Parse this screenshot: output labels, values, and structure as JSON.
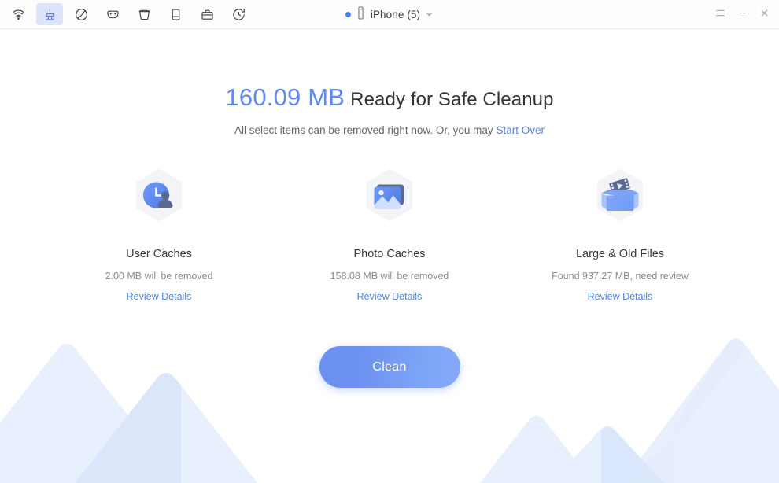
{
  "window": {
    "toolbar_icons": [
      {
        "name": "radar-scan-icon",
        "label": "Scan",
        "active": false
      },
      {
        "name": "broom-clean-icon",
        "label": "Clean",
        "active": true
      },
      {
        "name": "blocked-circle-icon",
        "label": "Block",
        "active": false
      },
      {
        "name": "privacy-mask-icon",
        "label": "Privacy",
        "active": false
      },
      {
        "name": "trash-bucket-icon",
        "label": "Erase",
        "active": false
      },
      {
        "name": "mobile-device-icon",
        "label": "Device",
        "active": false
      },
      {
        "name": "briefcase-toolbox-icon",
        "label": "Toolbox",
        "active": false
      },
      {
        "name": "clock-history-icon",
        "label": "History",
        "active": false
      }
    ],
    "device": {
      "status_dot_color": "#4a7bf7",
      "label": "iPhone (5)",
      "chevron": "chevron-down-icon"
    },
    "controls": {
      "menu": "hamburger-menu-icon",
      "minimize": "minimize-icon",
      "close": "close-icon"
    }
  },
  "main": {
    "headline": {
      "size": "160.09 MB",
      "size_color": "#5b8bf0",
      "phrase": "Ready for Safe Cleanup"
    },
    "subline": {
      "text": "All select items can be removed right now. Or, you may ",
      "link": "Start Over",
      "link_color": "#4f84e8"
    },
    "cards": [
      {
        "icon": "user-clock-cache-icon",
        "title": "User Caches",
        "subtitle": "2.00 MB will be removed",
        "link": "Review Details"
      },
      {
        "icon": "photo-image-cache-icon",
        "title": "Photo Caches",
        "subtitle": "158.08 MB will be removed",
        "link": "Review Details"
      },
      {
        "icon": "box-large-old-files-icon",
        "title": "Large & Old Files",
        "subtitle": "Found 937.27 MB, need review",
        "link": "Review Details"
      }
    ],
    "primary_button": {
      "label": "Clean",
      "gradient_from": "#6b8ff0",
      "gradient_to": "#86aaf8"
    }
  },
  "decoration": {
    "mountain_color_light": "#eaf1fd",
    "mountain_color_mid": "#dde8fb",
    "mountain_color_overlap": "#cfe0fa"
  }
}
